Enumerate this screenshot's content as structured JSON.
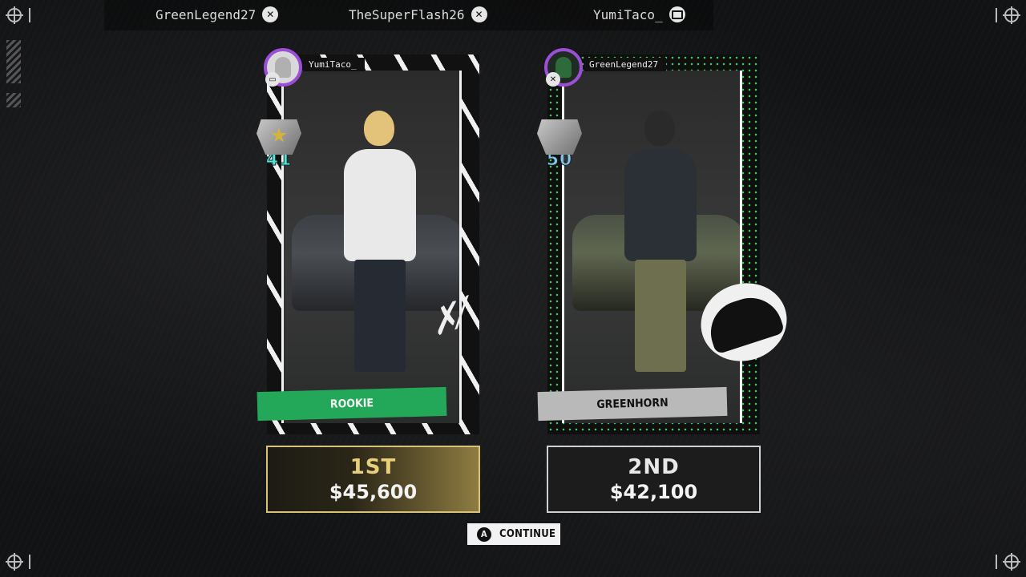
{
  "top_bar": {
    "players": [
      {
        "name": "GreenLegend27",
        "platform": "xbox-icon"
      },
      {
        "name": "TheSuperFlash26",
        "platform": "xbox-icon"
      },
      {
        "name": "YumiTaco_",
        "platform": "pc-icon"
      }
    ]
  },
  "results": [
    {
      "player": "YumiTaco_",
      "platform": "pc-icon",
      "level": "41",
      "rank_title": "ROOKIE",
      "place": "1ST",
      "earnings": "$45,600"
    },
    {
      "player": "GreenLegend27",
      "platform": "xbox-icon",
      "level": "50",
      "rank_title": "GREENHORN",
      "place": "2ND",
      "earnings": "$42,100"
    }
  ],
  "footer": {
    "continue_button_glyph": "A",
    "continue_label": "CONTINUE"
  },
  "colors": {
    "first_place_gold": "#e8cf7c",
    "rookie_banner_green": "#23a85a",
    "avatar_ring_purple": "#9b4fd6",
    "greenhorn_accent": "#39d353"
  }
}
